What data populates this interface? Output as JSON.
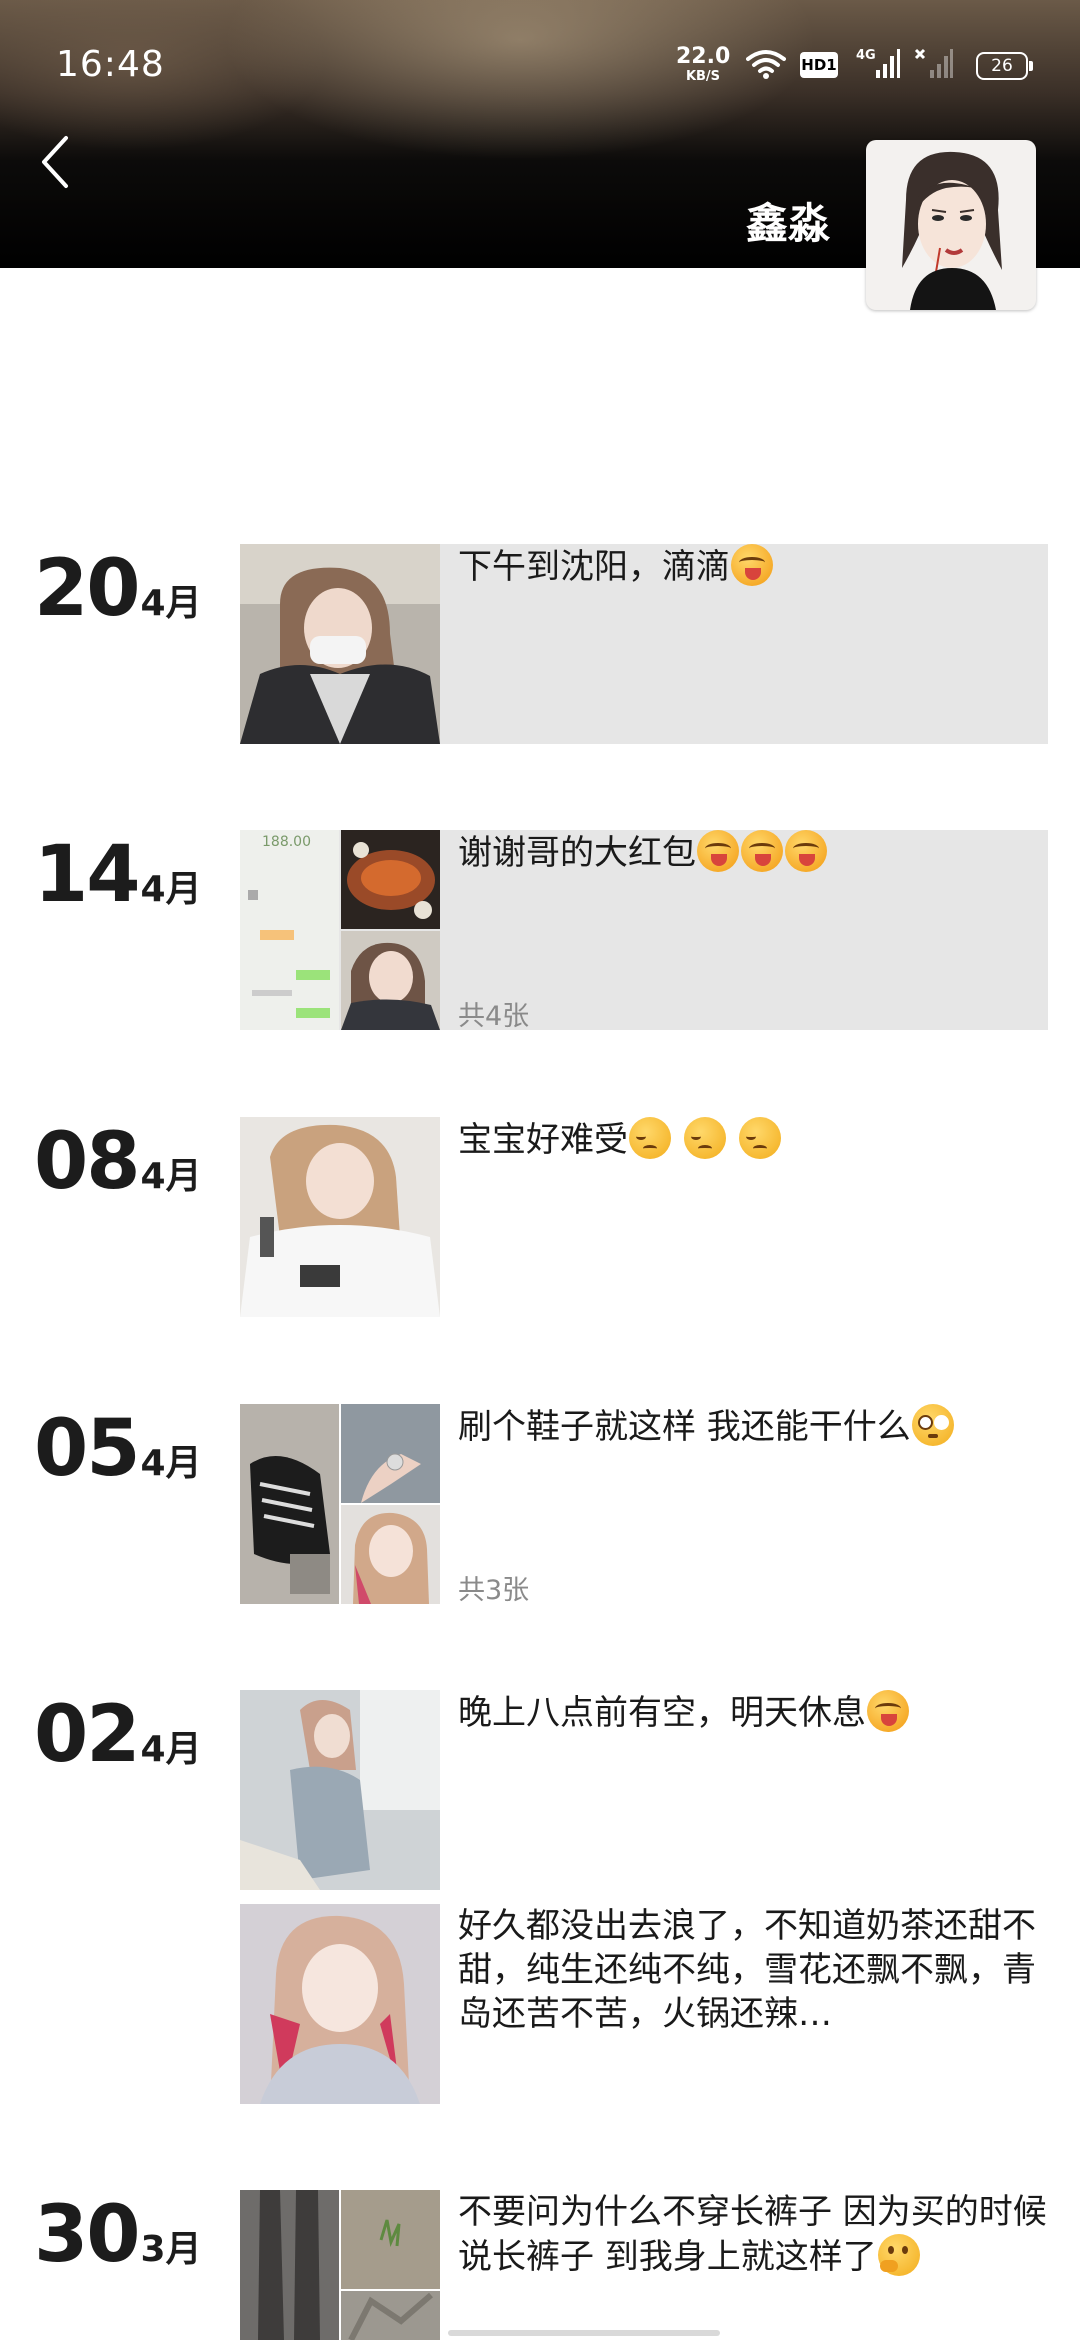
{
  "status_bar": {
    "time": "16:48",
    "net_speed_value": "22.0",
    "net_speed_unit": "KB/S",
    "hd_label": "HD1",
    "signal_label": "4G",
    "battery": "26"
  },
  "header": {
    "username": "鑫淼",
    "back_icon": "chevron-left-icon"
  },
  "posts": [
    {
      "day": "20",
      "month": "4月",
      "text": "下午到沈阳，滴滴",
      "emojis": [
        "drool"
      ],
      "count": ""
    },
    {
      "day": "14",
      "month": "4月",
      "text": "谢谢哥的大红包",
      "emojis": [
        "drool",
        "drool",
        "drool"
      ],
      "count": "共4张",
      "receipt_amount": "188.00"
    },
    {
      "day": "08",
      "month": "4月",
      "text": "宝宝好难受",
      "emojis": [
        "pensive",
        "pensive",
        "pensive"
      ],
      "count": ""
    },
    {
      "day": "05",
      "month": "4月",
      "text": "刷个鞋子就这样 我还能干什么",
      "emojis": [
        "flushed"
      ],
      "count": "共3张"
    },
    {
      "day": "02",
      "month": "4月",
      "text": "晚上八点前有空，明天休息",
      "emojis": [
        "drool"
      ],
      "count": ""
    },
    {
      "day": "",
      "month": "",
      "text": "好久都没出去浪了，不知道奶茶还甜不甜，纯生还纯不纯，雪花还飘不飘，青岛还苦不苦，火锅还辣…",
      "emojis": [],
      "count": ""
    },
    {
      "day": "30",
      "month": "3月",
      "text": "不要问为什么不穿长裤子 因为买的时候说长裤子 到我身上就这样了",
      "emojis": [
        "thinking"
      ],
      "count": ""
    }
  ],
  "colors": {
    "post_bg": "#e6e6e6",
    "count_text": "#8a8a8a",
    "text": "#1a1a1a"
  }
}
